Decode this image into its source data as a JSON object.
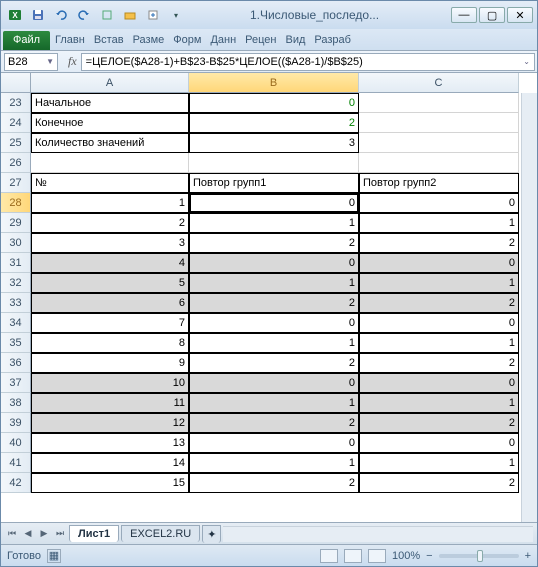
{
  "title": "1.Числовые_последо...",
  "file_tab": "Файл",
  "ribbon_tabs": [
    "Главн",
    "Встав",
    "Разме",
    "Форм",
    "Данн",
    "Рецен",
    "Вид",
    "Разраб"
  ],
  "name_box": "B28",
  "fx_label": "fx",
  "formula": "=ЦЕЛОЕ($A28-1)+B$23-B$25*ЦЕЛОЕ(($A28-1)/$B$25)",
  "col_headers": [
    "A",
    "B",
    "C"
  ],
  "row_start": 23,
  "rows": [
    {
      "n": 23,
      "A": "Начальное",
      "B": "0",
      "B_green": true
    },
    {
      "n": 24,
      "A": "Конечное",
      "B": "2",
      "B_green": true
    },
    {
      "n": 25,
      "A": "Количество значений",
      "B": "3"
    },
    {
      "n": 26,
      "blank": true
    },
    {
      "n": 27,
      "A": "№",
      "B": "Повтор групп1",
      "C": "Повтор групп2",
      "header": true
    },
    {
      "n": 28,
      "A": "1",
      "B": "0",
      "C": "0",
      "active_B": true
    },
    {
      "n": 29,
      "A": "2",
      "B": "1",
      "C": "1"
    },
    {
      "n": 30,
      "A": "3",
      "B": "2",
      "C": "2"
    },
    {
      "n": 31,
      "A": "4",
      "B": "0",
      "C": "0",
      "shaded": true
    },
    {
      "n": 32,
      "A": "5",
      "B": "1",
      "C": "1",
      "shaded": true
    },
    {
      "n": 33,
      "A": "6",
      "B": "2",
      "C": "2",
      "shaded": true
    },
    {
      "n": 34,
      "A": "7",
      "B": "0",
      "C": "0"
    },
    {
      "n": 35,
      "A": "8",
      "B": "1",
      "C": "1"
    },
    {
      "n": 36,
      "A": "9",
      "B": "2",
      "C": "2"
    },
    {
      "n": 37,
      "A": "10",
      "B": "0",
      "C": "0",
      "shaded": true
    },
    {
      "n": 38,
      "A": "11",
      "B": "1",
      "C": "1",
      "shaded": true
    },
    {
      "n": 39,
      "A": "12",
      "B": "2",
      "C": "2",
      "shaded": true
    },
    {
      "n": 40,
      "A": "13",
      "B": "0",
      "C": "0"
    },
    {
      "n": 41,
      "A": "14",
      "B": "1",
      "C": "1"
    },
    {
      "n": 42,
      "A": "15",
      "B": "2",
      "C": "2"
    }
  ],
  "sheet_tabs": [
    "Лист1",
    "EXCEL2.RU"
  ],
  "active_sheet": 0,
  "status_text": "Готово",
  "zoom": "100%",
  "chart_data": null
}
